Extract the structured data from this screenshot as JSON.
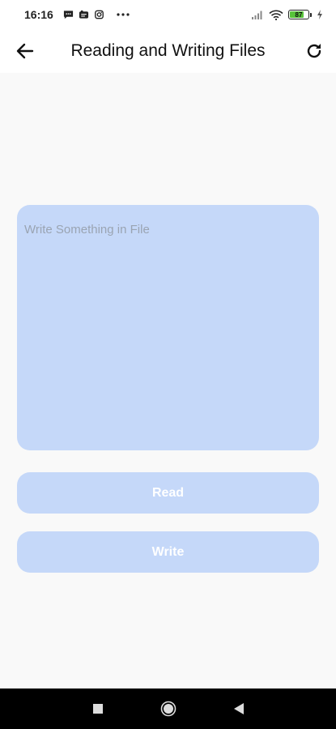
{
  "status_bar": {
    "time": "16:16",
    "battery_level": "87",
    "icons": [
      "message-icon",
      "news-icon",
      "instagram-icon",
      "more-dots-icon",
      "signal-icon",
      "wifi-icon",
      "battery-icon",
      "charging-icon"
    ]
  },
  "app_bar": {
    "title": "Reading and Writing Files",
    "back_icon": "arrow-left-icon",
    "refresh_icon": "refresh-icon"
  },
  "editor": {
    "placeholder": "Write Something in File",
    "value": ""
  },
  "buttons": {
    "read_label": "Read",
    "write_label": "Write"
  },
  "nav_bar": {
    "icons": [
      "recents-square-icon",
      "home-circle-icon",
      "back-triangle-icon"
    ]
  },
  "colors": {
    "accent_light": "#c5d8f9",
    "background": "#f9f9f9",
    "battery_green": "#58c33a"
  }
}
